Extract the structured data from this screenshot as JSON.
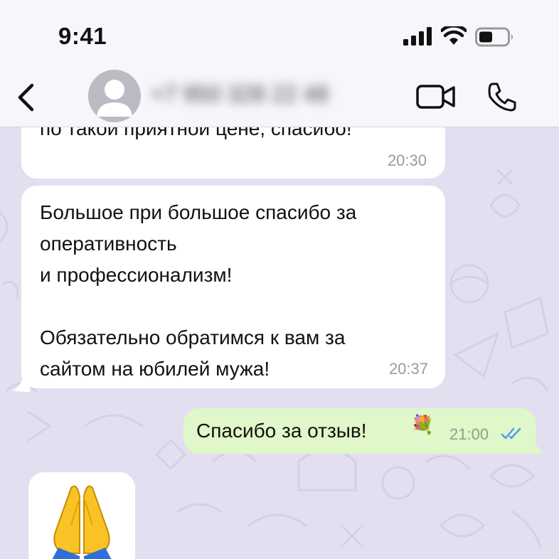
{
  "status_bar": {
    "time": "9:41"
  },
  "header": {
    "contact_name": "+7 950 328 22 48"
  },
  "messages": [
    {
      "id": "m1",
      "direction": "in",
      "text": "по такой приятной цене, спасибо!",
      "time": "20:30"
    },
    {
      "id": "m2",
      "direction": "in",
      "text": "Большое при большое спасибо за\nоперативность\nи профессионализм!\n\nОбязательно обратимся к вам за\nсайтом на юбилей мужа!",
      "time": "20:37"
    },
    {
      "id": "m3",
      "direction": "out",
      "text": "Спасибо за отзыв!",
      "emoji": "💐",
      "time": "21:00",
      "status": "read"
    },
    {
      "id": "m4",
      "direction": "in",
      "emoji": "🙏"
    }
  ],
  "colors": {
    "header_bg": "#f7f6fa",
    "chat_bg": "#e3dff0",
    "incoming_bubble": "#ffffff",
    "outgoing_bubble": "#dff7c9",
    "read_ticks": "#4a9df0"
  },
  "icons": {
    "back": "chevron-left-icon",
    "avatar": "person-silhouette-icon",
    "video": "video-camera-icon",
    "call": "phone-icon",
    "signal": "cellular-signal-icon",
    "wifi": "wifi-icon",
    "battery": "battery-icon",
    "read": "double-check-icon"
  }
}
